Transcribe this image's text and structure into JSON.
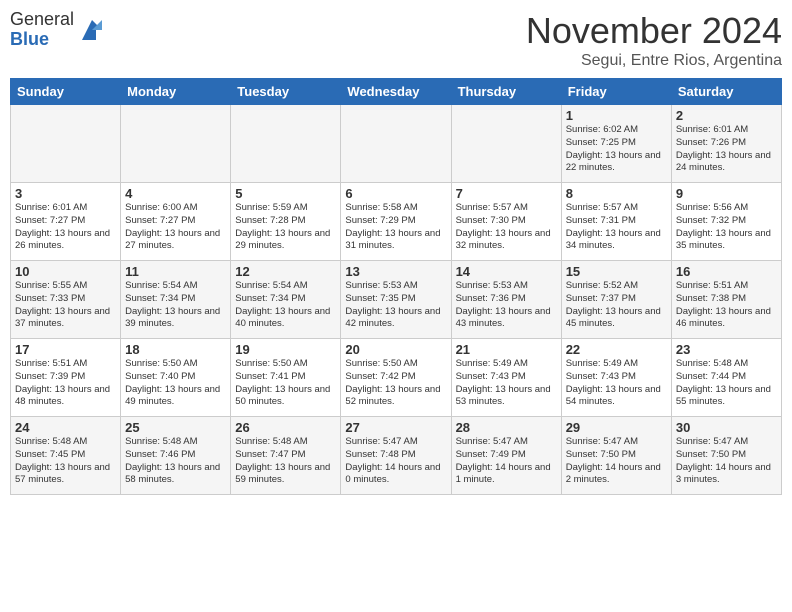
{
  "logo": {
    "general": "General",
    "blue": "Blue"
  },
  "header": {
    "month": "November 2024",
    "location": "Segui, Entre Rios, Argentina"
  },
  "days_of_week": [
    "Sunday",
    "Monday",
    "Tuesday",
    "Wednesday",
    "Thursday",
    "Friday",
    "Saturday"
  ],
  "weeks": [
    [
      {
        "day": "",
        "info": ""
      },
      {
        "day": "",
        "info": ""
      },
      {
        "day": "",
        "info": ""
      },
      {
        "day": "",
        "info": ""
      },
      {
        "day": "",
        "info": ""
      },
      {
        "day": "1",
        "info": "Sunrise: 6:02 AM\nSunset: 7:25 PM\nDaylight: 13 hours\nand 22 minutes."
      },
      {
        "day": "2",
        "info": "Sunrise: 6:01 AM\nSunset: 7:26 PM\nDaylight: 13 hours\nand 24 minutes."
      }
    ],
    [
      {
        "day": "3",
        "info": "Sunrise: 6:01 AM\nSunset: 7:27 PM\nDaylight: 13 hours\nand 26 minutes."
      },
      {
        "day": "4",
        "info": "Sunrise: 6:00 AM\nSunset: 7:27 PM\nDaylight: 13 hours\nand 27 minutes."
      },
      {
        "day": "5",
        "info": "Sunrise: 5:59 AM\nSunset: 7:28 PM\nDaylight: 13 hours\nand 29 minutes."
      },
      {
        "day": "6",
        "info": "Sunrise: 5:58 AM\nSunset: 7:29 PM\nDaylight: 13 hours\nand 31 minutes."
      },
      {
        "day": "7",
        "info": "Sunrise: 5:57 AM\nSunset: 7:30 PM\nDaylight: 13 hours\nand 32 minutes."
      },
      {
        "day": "8",
        "info": "Sunrise: 5:57 AM\nSunset: 7:31 PM\nDaylight: 13 hours\nand 34 minutes."
      },
      {
        "day": "9",
        "info": "Sunrise: 5:56 AM\nSunset: 7:32 PM\nDaylight: 13 hours\nand 35 minutes."
      }
    ],
    [
      {
        "day": "10",
        "info": "Sunrise: 5:55 AM\nSunset: 7:33 PM\nDaylight: 13 hours\nand 37 minutes."
      },
      {
        "day": "11",
        "info": "Sunrise: 5:54 AM\nSunset: 7:34 PM\nDaylight: 13 hours\nand 39 minutes."
      },
      {
        "day": "12",
        "info": "Sunrise: 5:54 AM\nSunset: 7:34 PM\nDaylight: 13 hours\nand 40 minutes."
      },
      {
        "day": "13",
        "info": "Sunrise: 5:53 AM\nSunset: 7:35 PM\nDaylight: 13 hours\nand 42 minutes."
      },
      {
        "day": "14",
        "info": "Sunrise: 5:53 AM\nSunset: 7:36 PM\nDaylight: 13 hours\nand 43 minutes."
      },
      {
        "day": "15",
        "info": "Sunrise: 5:52 AM\nSunset: 7:37 PM\nDaylight: 13 hours\nand 45 minutes."
      },
      {
        "day": "16",
        "info": "Sunrise: 5:51 AM\nSunset: 7:38 PM\nDaylight: 13 hours\nand 46 minutes."
      }
    ],
    [
      {
        "day": "17",
        "info": "Sunrise: 5:51 AM\nSunset: 7:39 PM\nDaylight: 13 hours\nand 48 minutes."
      },
      {
        "day": "18",
        "info": "Sunrise: 5:50 AM\nSunset: 7:40 PM\nDaylight: 13 hours\nand 49 minutes."
      },
      {
        "day": "19",
        "info": "Sunrise: 5:50 AM\nSunset: 7:41 PM\nDaylight: 13 hours\nand 50 minutes."
      },
      {
        "day": "20",
        "info": "Sunrise: 5:50 AM\nSunset: 7:42 PM\nDaylight: 13 hours\nand 52 minutes."
      },
      {
        "day": "21",
        "info": "Sunrise: 5:49 AM\nSunset: 7:43 PM\nDaylight: 13 hours\nand 53 minutes."
      },
      {
        "day": "22",
        "info": "Sunrise: 5:49 AM\nSunset: 7:43 PM\nDaylight: 13 hours\nand 54 minutes."
      },
      {
        "day": "23",
        "info": "Sunrise: 5:48 AM\nSunset: 7:44 PM\nDaylight: 13 hours\nand 55 minutes."
      }
    ],
    [
      {
        "day": "24",
        "info": "Sunrise: 5:48 AM\nSunset: 7:45 PM\nDaylight: 13 hours\nand 57 minutes."
      },
      {
        "day": "25",
        "info": "Sunrise: 5:48 AM\nSunset: 7:46 PM\nDaylight: 13 hours\nand 58 minutes."
      },
      {
        "day": "26",
        "info": "Sunrise: 5:48 AM\nSunset: 7:47 PM\nDaylight: 13 hours\nand 59 minutes."
      },
      {
        "day": "27",
        "info": "Sunrise: 5:47 AM\nSunset: 7:48 PM\nDaylight: 14 hours\nand 0 minutes."
      },
      {
        "day": "28",
        "info": "Sunrise: 5:47 AM\nSunset: 7:49 PM\nDaylight: 14 hours\nand 1 minute."
      },
      {
        "day": "29",
        "info": "Sunrise: 5:47 AM\nSunset: 7:50 PM\nDaylight: 14 hours\nand 2 minutes."
      },
      {
        "day": "30",
        "info": "Sunrise: 5:47 AM\nSunset: 7:50 PM\nDaylight: 14 hours\nand 3 minutes."
      }
    ]
  ]
}
